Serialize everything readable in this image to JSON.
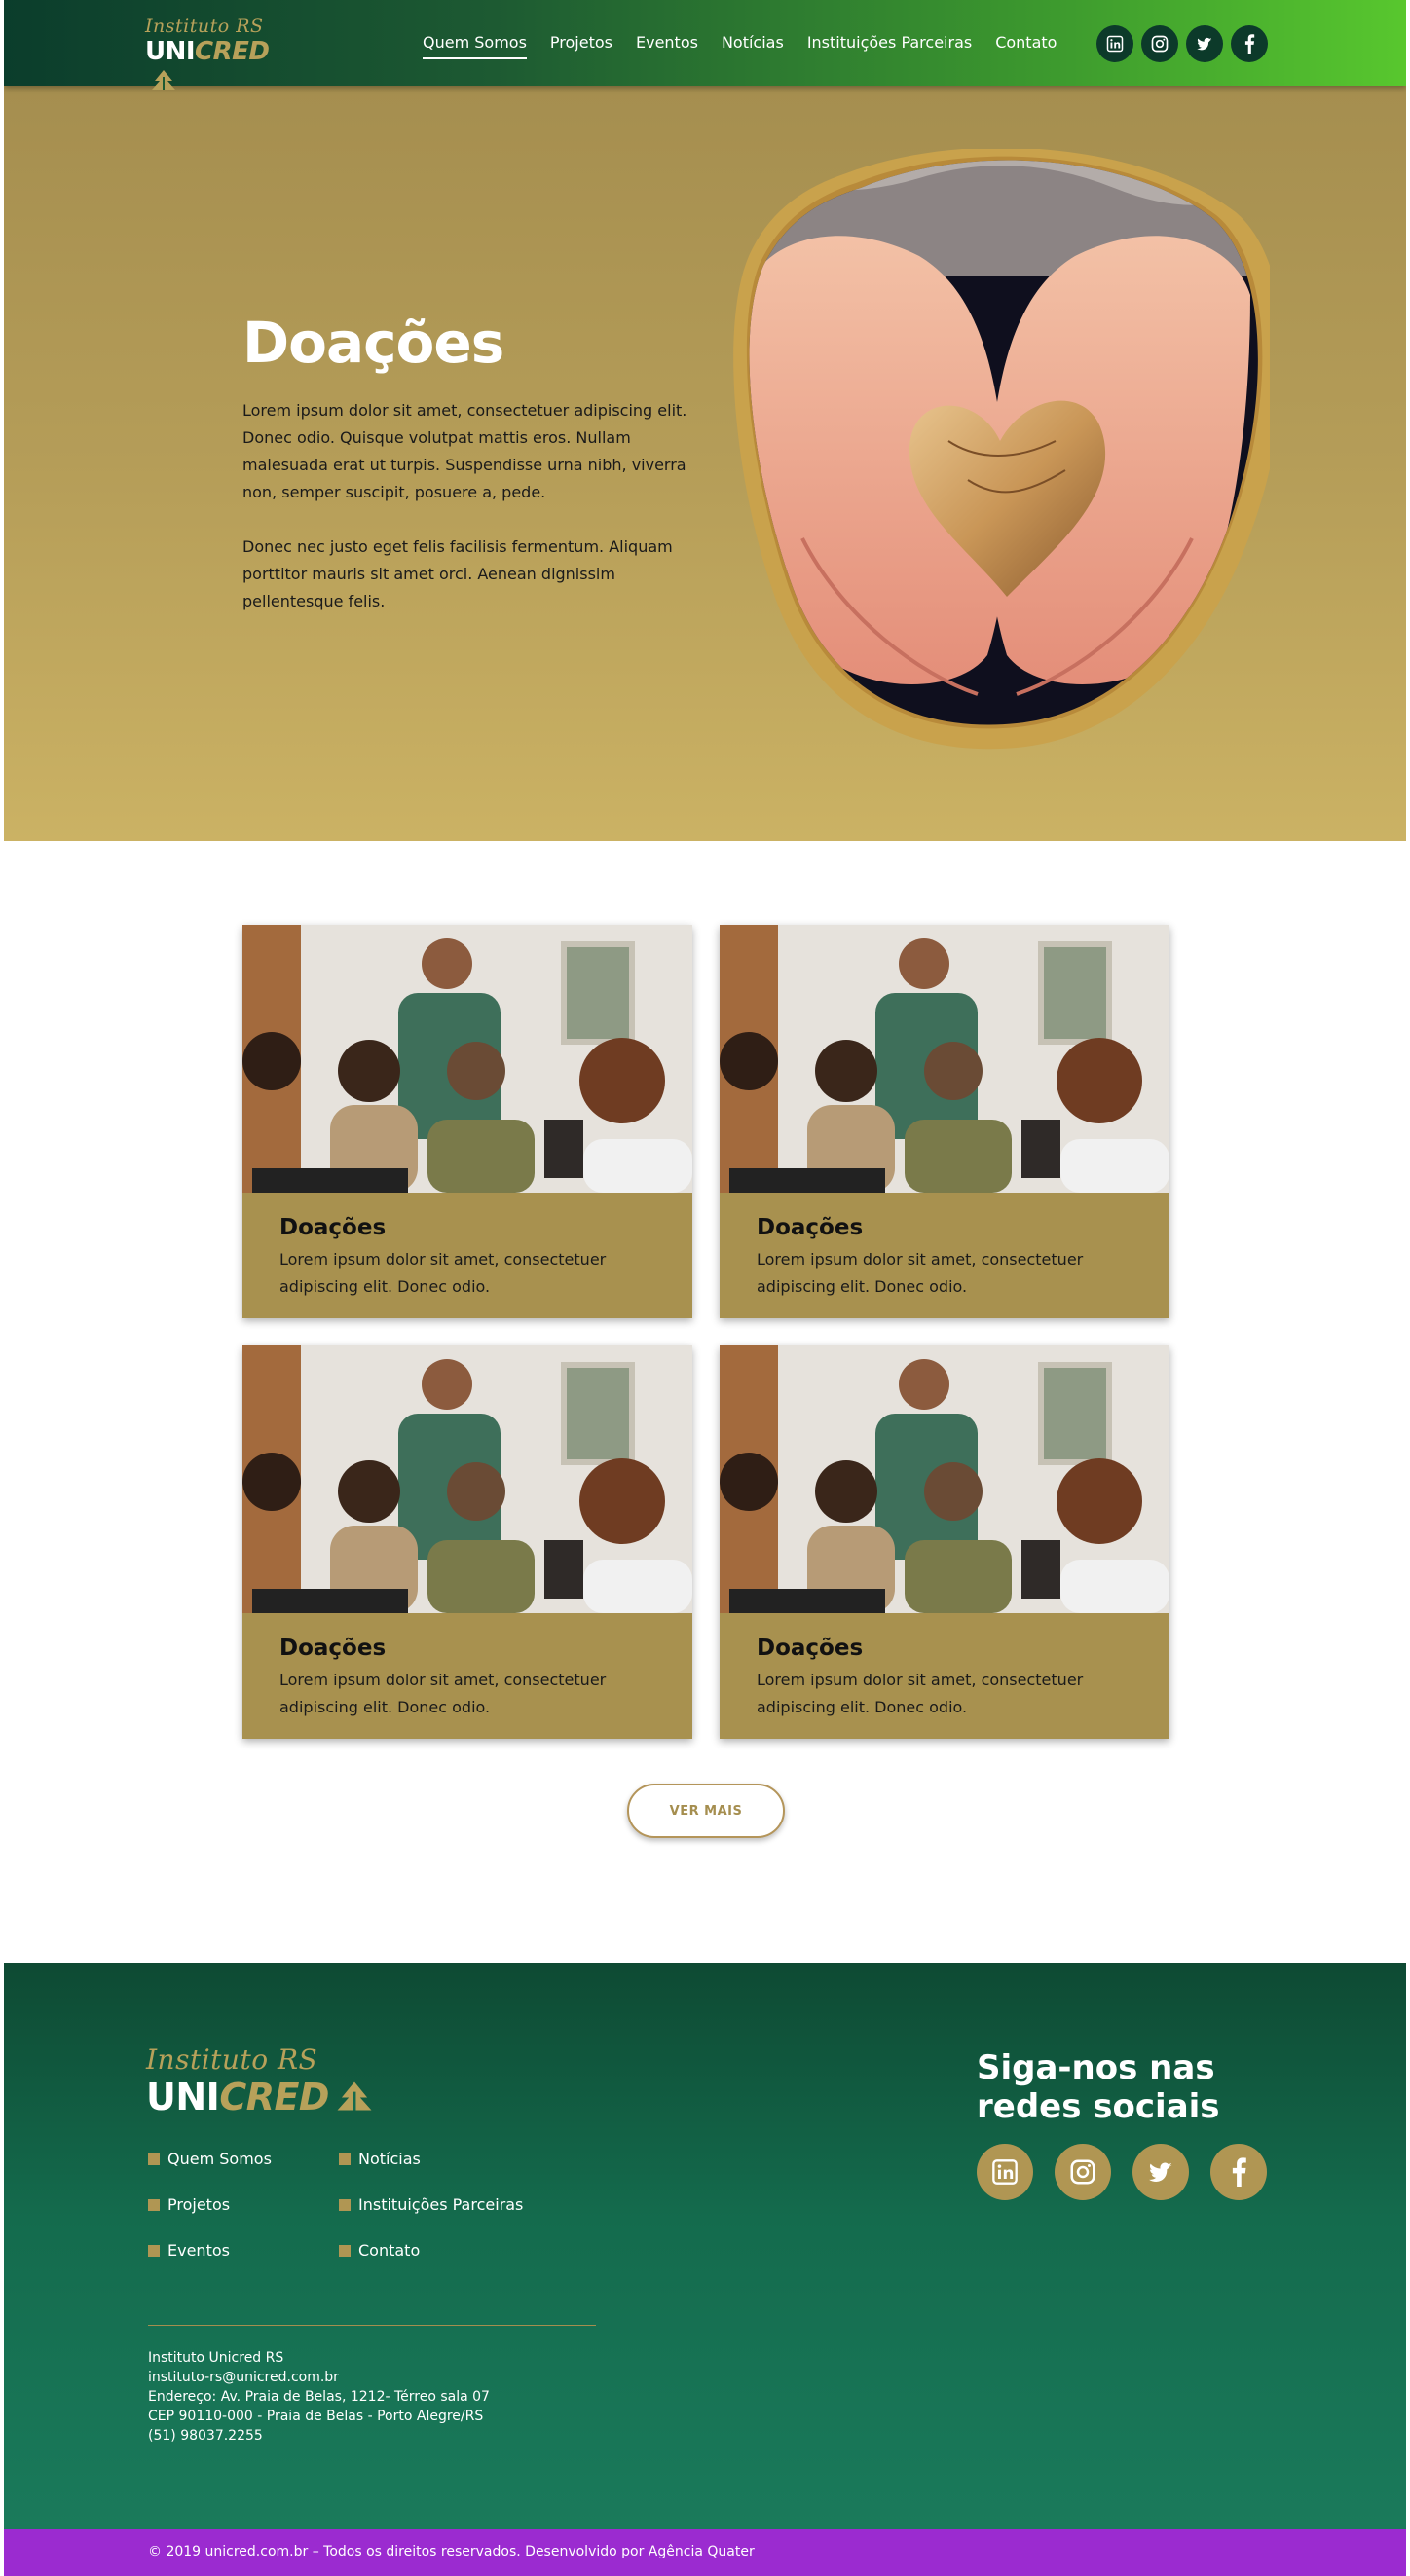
{
  "header": {
    "logo": {
      "script": "Instituto RS",
      "uni": "UNI",
      "cred": "CRED"
    },
    "nav": [
      "Quem Somos",
      "Projetos",
      "Eventos",
      "Notícias",
      "Instituições Parceiras",
      "Contato"
    ],
    "active_nav": "Quem Somos",
    "social_icons": [
      "linkedin-icon",
      "instagram-icon",
      "twitter-icon",
      "facebook-icon"
    ]
  },
  "hero": {
    "title": "Doações",
    "paragraphs": [
      "Lorem ipsum dolor sit amet, consectetuer adipiscing elit. Donec odio. Quisque volutpat mattis eros. Nullam malesuada erat ut turpis. Suspendisse urna nibh, viverra non, semper suscipit, posuere a, pede.",
      "Donec nec justo eget felis facilisis fermentum. Aliquam porttitor mauris sit amet orci. Aenean dignissim pellentesque felis."
    ]
  },
  "cards": [
    {
      "title": "Doações",
      "desc": "Lorem ipsum dolor sit amet, consectetuer adipiscing elit. Donec odio."
    },
    {
      "title": "Doações",
      "desc": "Lorem ipsum dolor sit amet, consectetuer adipiscing elit. Donec odio."
    },
    {
      "title": "Doações",
      "desc": "Lorem ipsum dolor sit amet, consectetuer adipiscing elit. Donec odio."
    },
    {
      "title": "Doações",
      "desc": "Lorem ipsum dolor sit amet, consectetuer adipiscing elit. Donec odio."
    }
  ],
  "ver_mais": "VER MAIS",
  "footer": {
    "logo": {
      "script": "Instituto RS",
      "uni": "UNI",
      "cred": "CRED"
    },
    "links": [
      "Quem Somos",
      "Notícias",
      "Projetos",
      "Instituições Parceiras",
      "Eventos",
      "Contato"
    ],
    "contact": [
      "Instituto Unicred RS",
      "instituto-rs@unicred.com.br",
      "Endereço: Av. Praia de Belas, 1212- Térreo sala 07",
      "CEP 90110-000 - Praia de Belas - Porto Alegre/RS",
      "(51) 98037.2255"
    ],
    "social_title": "Siga-nos nas redes sociais",
    "social_icons": [
      "linkedin-icon",
      "instagram-icon",
      "twitter-icon",
      "facebook-icon"
    ]
  },
  "copyright": "© 2019 unicred.com.br – Todos os direitos reservados. Desenvolvido por Agência Quater",
  "colors": {
    "header_start": "#0b3d2c",
    "header_end": "#58c72e",
    "gold": "#a8914f",
    "footer": "#146b4d",
    "copyright_bar": "#9b2bd0"
  }
}
